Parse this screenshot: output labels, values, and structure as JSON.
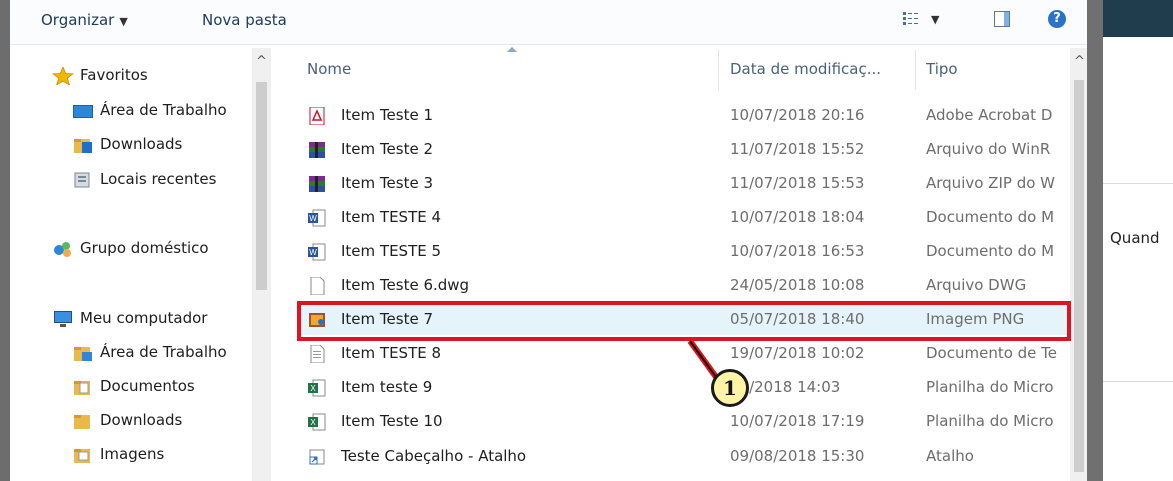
{
  "toolbar": {
    "organize_label": "Organizar",
    "new_folder_label": "Nova pasta"
  },
  "nav": {
    "items": [
      {
        "label": "Favoritos",
        "icon": "star-icon"
      },
      {
        "label": "Área de Trabalho",
        "icon": "desktop-icon"
      },
      {
        "label": "Downloads",
        "icon": "downloads-folder-icon"
      },
      {
        "label": "Locais recentes",
        "icon": "recent-places-icon"
      },
      {
        "label": "Grupo doméstico",
        "icon": "homegroup-icon"
      },
      {
        "label": "Meu computador",
        "icon": "computer-icon"
      },
      {
        "label": "Área de Trabalho",
        "icon": "desktop-folder-icon"
      },
      {
        "label": "Documentos",
        "icon": "documents-icon"
      },
      {
        "label": "Downloads",
        "icon": "downloads-folder-icon"
      },
      {
        "label": "Imagens",
        "icon": "images-icon"
      }
    ]
  },
  "columns": {
    "name": "Nome",
    "date": "Data de modificaç...",
    "type": "Tipo"
  },
  "files": [
    {
      "name": "Item Teste 1",
      "date": "10/07/2018 20:16",
      "type": "Adobe Acrobat D",
      "icon": "pdf-icon"
    },
    {
      "name": "Item Teste 2",
      "date": "11/07/2018 15:52",
      "type": "Arquivo do WinR",
      "icon": "winrar-icon"
    },
    {
      "name": "Item Teste 3",
      "date": "11/07/2018 15:53",
      "type": "Arquivo ZIP do W",
      "icon": "winrar-icon"
    },
    {
      "name": "Item TESTE 4",
      "date": "10/07/2018 18:04",
      "type": "Documento do M",
      "icon": "word-icon"
    },
    {
      "name": "Item TESTE 5",
      "date": "10/07/2018 16:53",
      "type": "Documento do M",
      "icon": "word-icon"
    },
    {
      "name": "Item Teste 6.dwg",
      "date": "24/05/2018 10:08",
      "type": "Arquivo DWG",
      "icon": "blank-file-icon"
    },
    {
      "name": "Item Teste 7",
      "date": "05/07/2018 18:40",
      "type": "Imagem PNG",
      "icon": "png-image-icon",
      "selected": true
    },
    {
      "name": "Item TESTE 8",
      "date": "19/07/2018 10:02",
      "type": "Documento de Te",
      "icon": "text-file-icon"
    },
    {
      "name": "Item teste 9",
      "date": "07/2018 14:03",
      "type": "Planilha do Micro",
      "icon": "excel-icon"
    },
    {
      "name": "Item Teste 10",
      "date": "10/07/2018 17:19",
      "type": "Planilha do Micro",
      "icon": "excel-icon"
    },
    {
      "name": "Teste Cabeçalho - Atalho",
      "date": "09/08/2018 15:30",
      "type": "Atalho",
      "icon": "shortcut-icon"
    }
  ],
  "annotation": {
    "number": "1",
    "color": "#e0131f"
  },
  "background_page": {
    "text": "Quand"
  }
}
